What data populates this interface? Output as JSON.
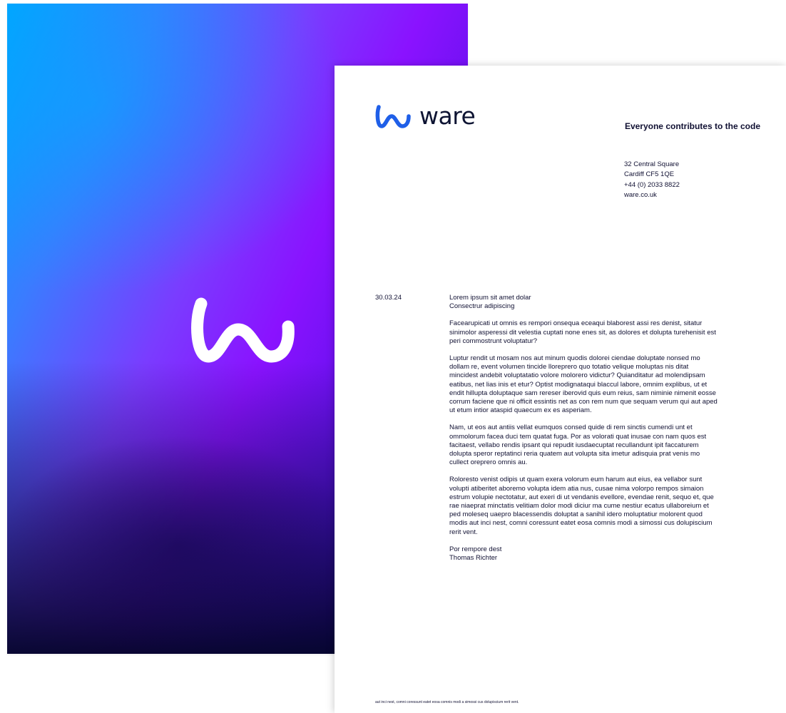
{
  "brand": {
    "name": "ware",
    "mark_icon": "wave-w-icon",
    "colors": {
      "logo_blue": "#1f5fe8",
      "wordmark": "#0e1433",
      "gradient_start": "#00a6ff",
      "gradient_mid": "#8a12ff",
      "gradient_end": "#03052a"
    }
  },
  "letterhead": {
    "tagline": "Everyone contributes to the code",
    "address": {
      "line1": "32 Central Square",
      "line2": "Cardiff CF5 1QE",
      "phone": "+44 (0) 2033 8822",
      "web": "ware.co.uk"
    }
  },
  "letter": {
    "date": "30.03.24",
    "subject_line1": "Lorem ipsum sit amet dolar",
    "subject_line2": "Consectrur adipiscing",
    "paragraphs": [
      "Facearupicati ut omnis es rempori onsequa eceaqui blaborest assi res denist, sitatur sinimolor asperessi dit velestia cuptati none enes sit, as dolores et dolupta turehenisit est peri commostrunt voluptatur?",
      "Luptur rendit ut mosam nos aut minum quodis dolorei ciendae doluptate nonsed mo dollam re, event volumen tincide lloreprero quo totatio velique moluptas nis ditat mincidest andebit voluptatatio volore molorero vidictur? Quianditatur ad molendipsam eatibus, net lias inis et etur? Optist modignataqui blaccul labore, omnim explibus, ut et endit hillupta doluptaque sam rereser iberovid quis eum reius, sam niminie nimenit eosse corrum faciene que ni officit essintis net as con rem num que sequam verum qui aut aped ut etum intior ataspid quaecum ex es asperiam.",
      "Nam, ut eos aut antiis vellat eumquos consed quide di rem sinctis cumendi unt et ommolorum facea duci tem quatat fuga. Por as volorati quat inusae con nam quos est facitaest, vellabo rendis ipsant qui repudit iusdaecuptat recullandunt ipit faccaturem dolupta speror reptatinci reria quatem aut volupta sita imetur adisquia prat venis mo cullect oreprero omnis au.",
      "Roloresto venist odipis ut quam exera volorum eum harum aut eius, ea vellabor sunt volupti atiberitet aboremo volupta idem atia nus, cusae nima volorpo rempos simaion estrum volupie nectotatur, aut exeri di ut vendanis evellore, evendae renit, sequo et, que rae niaeprat minctatis velitiam dolor modi diciur ma cume nestiur ecatus ullaboreium et ped moleseq uaepro blacessendis doluptat a sanihil idero moluptatiur molorent quod modis aut inci nest, comni coressunt eatet eosa comnis modi a simossi cus dolupiscium rerit vent."
    ],
    "signoff": "Por rempore dest",
    "signatory": "Thomas Richter"
  },
  "footer": {
    "text": "aut inci nest, comni coressunt eatet eosa comnis modi a simossi cus dolupiscium rerit vent."
  }
}
